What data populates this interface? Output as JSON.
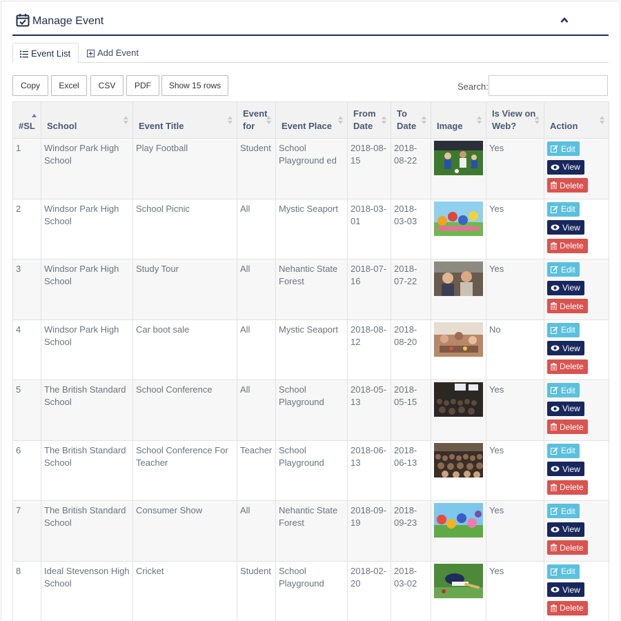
{
  "header": {
    "title": "Manage Event"
  },
  "tabs": [
    {
      "label": "Event List"
    },
    {
      "label": "Add Event"
    }
  ],
  "toolbar": {
    "buttons": [
      "Copy",
      "Excel",
      "CSV",
      "PDF",
      "Show 15 rows"
    ],
    "search_label": "Search:"
  },
  "table": {
    "columns": [
      "#SL",
      "School",
      "Event Title",
      "Event for",
      "Event Place",
      "From Date",
      "To Date",
      "Image",
      "Is View on Web?",
      "Action"
    ],
    "action_labels": {
      "edit": "Edit",
      "view": "View",
      "delete": "Delete"
    },
    "rows": [
      {
        "sl": "1",
        "school": "Windsor Park High School",
        "title": "Play Football",
        "for": "Student",
        "place": "School Playground ed",
        "from": "2018-08-15",
        "to": "2018-08-22",
        "image": "football-photo",
        "web": "Yes"
      },
      {
        "sl": "2",
        "school": "Windsor Park High School",
        "title": "School Picnic",
        "for": "All",
        "place": "Mystic Seaport",
        "from": "2018-03-01",
        "to": "2018-03-03",
        "image": "cartoon-picnic-photo",
        "web": "Yes"
      },
      {
        "sl": "3",
        "school": "Windsor Park High School",
        "title": "Study Tour",
        "for": "All",
        "place": "Nehantic State Forest",
        "from": "2018-07-16",
        "to": "2018-07-22",
        "image": "students-tour-photo",
        "web": "Yes"
      },
      {
        "sl": "4",
        "school": "Windsor Park High School",
        "title": "Car boot sale",
        "for": "All",
        "place": "Mystic Seaport",
        "from": "2018-08-12",
        "to": "2018-08-20",
        "image": "market-sale-photo",
        "web": "No"
      },
      {
        "sl": "5",
        "school": "The British Standard School",
        "title": "School Conference",
        "for": "All",
        "place": "School Playground",
        "from": "2018-05-13",
        "to": "2018-05-15",
        "image": "conference-hall-photo",
        "web": "Yes"
      },
      {
        "sl": "6",
        "school": "The British Standard School",
        "title": "School Conference For Teacher",
        "for": "Teacher",
        "place": "School Playground",
        "from": "2018-06-13",
        "to": "2018-06-13",
        "image": "teacher-conference-photo",
        "web": "Yes"
      },
      {
        "sl": "7",
        "school": "The British Standard School",
        "title": "Consumer Show",
        "for": "All",
        "place": "Nehantic State Forest",
        "from": "2018-09-19",
        "to": "2018-09-23",
        "image": "cartoon-show-photo",
        "web": "Yes"
      },
      {
        "sl": "8",
        "school": "Ideal Stevenson High School",
        "title": "Cricket",
        "for": "Student",
        "place": "School Playground",
        "from": "2018-02-20",
        "to": "2018-03-02",
        "image": "cricket-photo",
        "web": "Yes"
      }
    ]
  },
  "colors": {
    "accent": "#1b2a6b",
    "edit": "#5bc0de",
    "view": "#18275c",
    "delete": "#d9534f",
    "header_bg": "#f2f2f2"
  }
}
